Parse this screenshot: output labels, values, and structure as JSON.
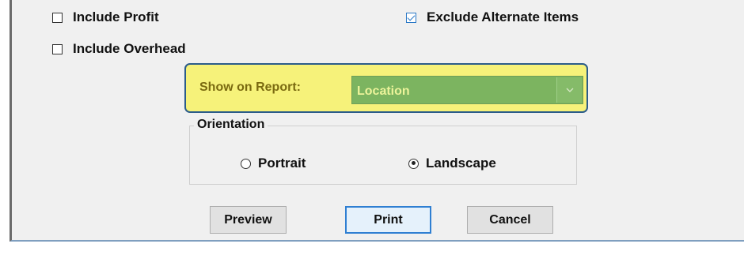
{
  "options": {
    "include_profit": {
      "label": "Include Profit",
      "checked": false
    },
    "include_overhead": {
      "label": "Include Overhead",
      "checked": false
    },
    "exclude_alternate_items": {
      "label": "Exclude Alternate Items",
      "checked": true
    }
  },
  "report": {
    "show_label": "Show on Report:",
    "selected": "Location",
    "highlight_color": "#f6f27a",
    "dropdown_color": "#7cb460"
  },
  "orientation": {
    "title": "Orientation",
    "options": [
      {
        "label": "Portrait",
        "selected": false
      },
      {
        "label": "Landscape",
        "selected": true
      }
    ]
  },
  "buttons": {
    "preview": "Preview",
    "print": "Print",
    "cancel": "Cancel"
  },
  "icons": {
    "dropdown": "chevron-down-icon"
  }
}
